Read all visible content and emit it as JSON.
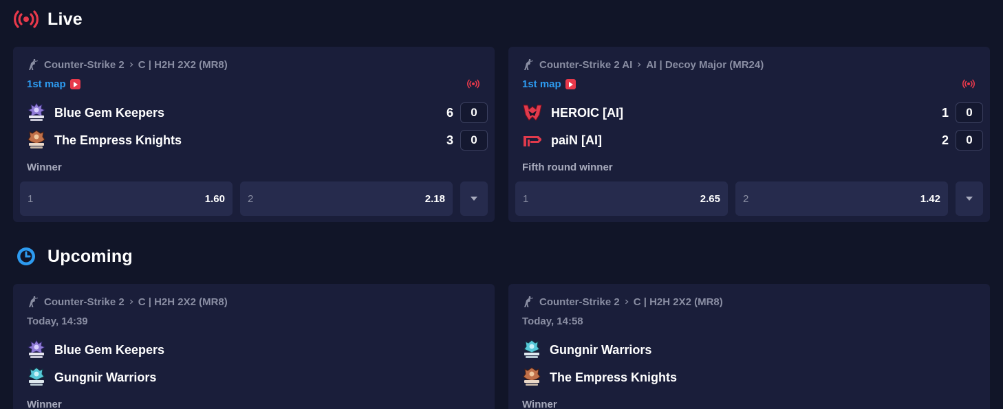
{
  "sections": {
    "live": {
      "title": "Live"
    },
    "upcoming": {
      "title": "Upcoming"
    }
  },
  "colors": {
    "live_red": "#e8394b",
    "accent_blue": "#2d9bf0",
    "card_bg": "#1a1e3a",
    "page_bg": "#111528"
  },
  "live_matches": [
    {
      "game": "Counter-Strike 2",
      "tournament": "C | H2H 2X2 (MR8)",
      "map_label": "1st map",
      "team1": {
        "name": "Blue Gem Keepers",
        "score": "6",
        "map_score": "0",
        "logo": "blue-gem-keepers-logo"
      },
      "team2": {
        "name": "The Empress Knights",
        "score": "3",
        "map_score": "0",
        "logo": "empress-knights-logo"
      },
      "market": "Winner",
      "odds": [
        {
          "label": "1",
          "value": "1.60"
        },
        {
          "label": "2",
          "value": "2.18"
        }
      ]
    },
    {
      "game": "Counter-Strike 2 AI",
      "tournament": "AI | Decoy Major (MR24)",
      "map_label": "1st map",
      "team1": {
        "name": "HEROIC [AI]",
        "score": "1",
        "map_score": "0",
        "logo": "heroic-logo"
      },
      "team2": {
        "name": "paiN [AI]",
        "score": "2",
        "map_score": "0",
        "logo": "pain-logo"
      },
      "market": "Fifth round winner",
      "odds": [
        {
          "label": "1",
          "value": "2.65"
        },
        {
          "label": "2",
          "value": "1.42"
        }
      ]
    }
  ],
  "upcoming_matches": [
    {
      "game": "Counter-Strike 2",
      "tournament": "C | H2H 2X2 (MR8)",
      "time": "Today, 14:39",
      "team1": {
        "name": "Blue Gem Keepers",
        "logo": "blue-gem-keepers-logo"
      },
      "team2": {
        "name": "Gungnir Warriors",
        "logo": "gungnir-warriors-logo"
      },
      "market": "Winner"
    },
    {
      "game": "Counter-Strike 2",
      "tournament": "C | H2H 2X2 (MR8)",
      "time": "Today, 14:58",
      "team1": {
        "name": "Gungnir Warriors",
        "logo": "gungnir-warriors-logo"
      },
      "team2": {
        "name": "The Empress Knights",
        "logo": "empress-knights-logo"
      },
      "market": "Winner"
    }
  ]
}
